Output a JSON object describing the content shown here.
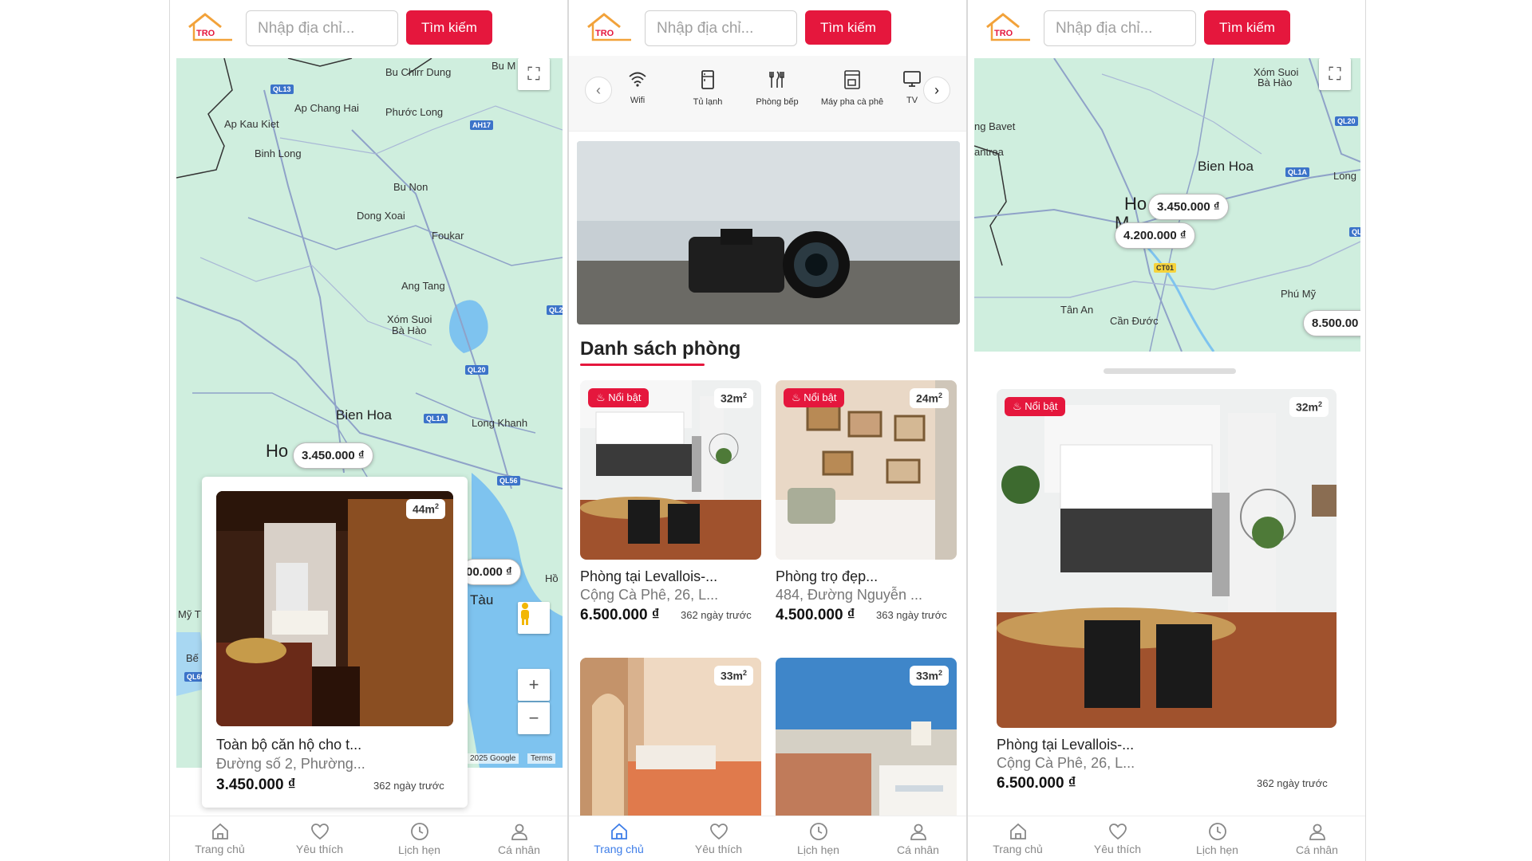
{
  "header": {
    "logo_text": "TRO",
    "address_placeholder": "Nhập địa chỉ...",
    "search_label": "Tìm kiếm"
  },
  "nav": {
    "home": "Trang chủ",
    "favorites": "Yêu thích",
    "appointments": "Lịch hẹn",
    "profile": "Cá nhân"
  },
  "screen1": {
    "map_labels": [
      "Bu Chirr Dung",
      "Bu M",
      "Ap Chang Hai",
      "Phước Long",
      "Ap Kau Kiet",
      "Binh Long",
      "Bu Non",
      "Dong Xoai",
      "Foukar",
      "Ang Tang",
      "Xóm Suoi",
      "Bà Hào",
      "Bien Hoa",
      "Long Khanh",
      "Ho",
      "Tàu",
      "Hồ",
      "Mỹ T",
      "Bế"
    ],
    "road_badges": [
      "QL13",
      "AH17",
      "QL2",
      "QL20",
      "QL1A",
      "QL56",
      "QL60"
    ],
    "price_pins": [
      "3.450.000 ₫",
      "00.000 ₫"
    ],
    "credit": "2025 Google",
    "terms": "Terms",
    "popup": {
      "area": "44m",
      "area_sup": "2",
      "title": "Toàn bộ căn hộ cho t...",
      "address": "Đường số 2, Phường...",
      "price": "3.450.000 ₫",
      "posted": "362 ngày trước"
    }
  },
  "screen2": {
    "amenities": [
      {
        "icon": "wifi-icon",
        "label": "Wifi"
      },
      {
        "icon": "fridge-icon",
        "label": "Tủ lạnh"
      },
      {
        "icon": "kitchen-icon",
        "label": "Phòng bếp"
      },
      {
        "icon": "coffee-machine-icon",
        "label": "Máy pha cà phê"
      },
      {
        "icon": "tv-icon",
        "label": "TV"
      }
    ],
    "section_title": "Danh sách phòng",
    "hot_label": "Nổi bật",
    "cards": [
      {
        "area": "32m",
        "hot": true,
        "title": "Phòng tại Levallois-...",
        "address": "Cộng Cà Phê, 26, L...",
        "price": "6.500.000 ₫",
        "posted": "362 ngày trước"
      },
      {
        "area": "24m",
        "hot": true,
        "title": "Phòng trọ đẹp...",
        "address": "484, Đường Nguyễn ...",
        "price": "4.500.000 ₫",
        "posted": "363 ngày trước"
      },
      {
        "area": "33m",
        "hot": false
      },
      {
        "area": "33m",
        "hot": false
      }
    ]
  },
  "screen3": {
    "map_labels": [
      "Xóm Suoi",
      "Bà Hào",
      "ng Bavet",
      "antrea",
      "Bien Hoa",
      "Long",
      "Ho",
      "M",
      "Phú Mỹ",
      "Tân An",
      "Cần Đước"
    ],
    "road_badges": [
      "QL20",
      "QL1A",
      "QL",
      "CT01"
    ],
    "price_pins": [
      "3.450.000 ₫",
      "4.200.000 ₫",
      "8.500.00"
    ],
    "card": {
      "hot": "Nổi bật",
      "area": "32m",
      "area_sup": "2",
      "title": "Phòng tại Levallois-...",
      "address": "Cộng Cà Phê, 26, L...",
      "price": "6.500.000 ₫",
      "posted": "362 ngày trước"
    }
  },
  "colors": {
    "accent": "#e5173d",
    "active_nav": "#3d7de8",
    "map_land": "#cfeede",
    "map_water": "#7ec3ef",
    "logo_orange": "#f2a23a"
  }
}
